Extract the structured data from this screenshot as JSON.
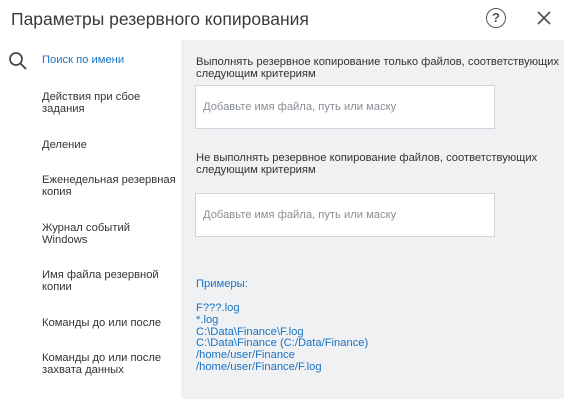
{
  "window": {
    "title": "Параметры резервного копирования",
    "help_label": "?"
  },
  "sidebar": {
    "items": [
      {
        "label": "Поиск по имени"
      },
      {
        "label": "Действия при сбое задания"
      },
      {
        "label": "Деление"
      },
      {
        "label": "Еженедельная резервная копия"
      },
      {
        "label": "Журнал событий Windows"
      },
      {
        "label": "Имя файла резервной копии"
      },
      {
        "label": "Команды до или после"
      },
      {
        "label": "Команды до или после захвата данных"
      }
    ]
  },
  "main": {
    "include_label": "Выполнять резервное копирование только файлов, соответствующих следующим критериям",
    "include_placeholder": "Добавьте имя файла, путь или маску",
    "exclude_label": "Не выполнять резервное копирование файлов, соответствующих следующим критериям",
    "exclude_placeholder": "Добавьте имя файла, путь или маску",
    "examples_title": "Примеры:",
    "examples": [
      "F???.log",
      "*.log",
      "C:\\Data\\Finance\\F.log",
      "C:\\Data\\Finance (C:/Data/Finance)",
      "/home/user/Finance",
      "/home/user/Finance/F.log"
    ]
  },
  "colors": {
    "accent": "#1a73c5",
    "panel_background": "#f0f1f3"
  }
}
